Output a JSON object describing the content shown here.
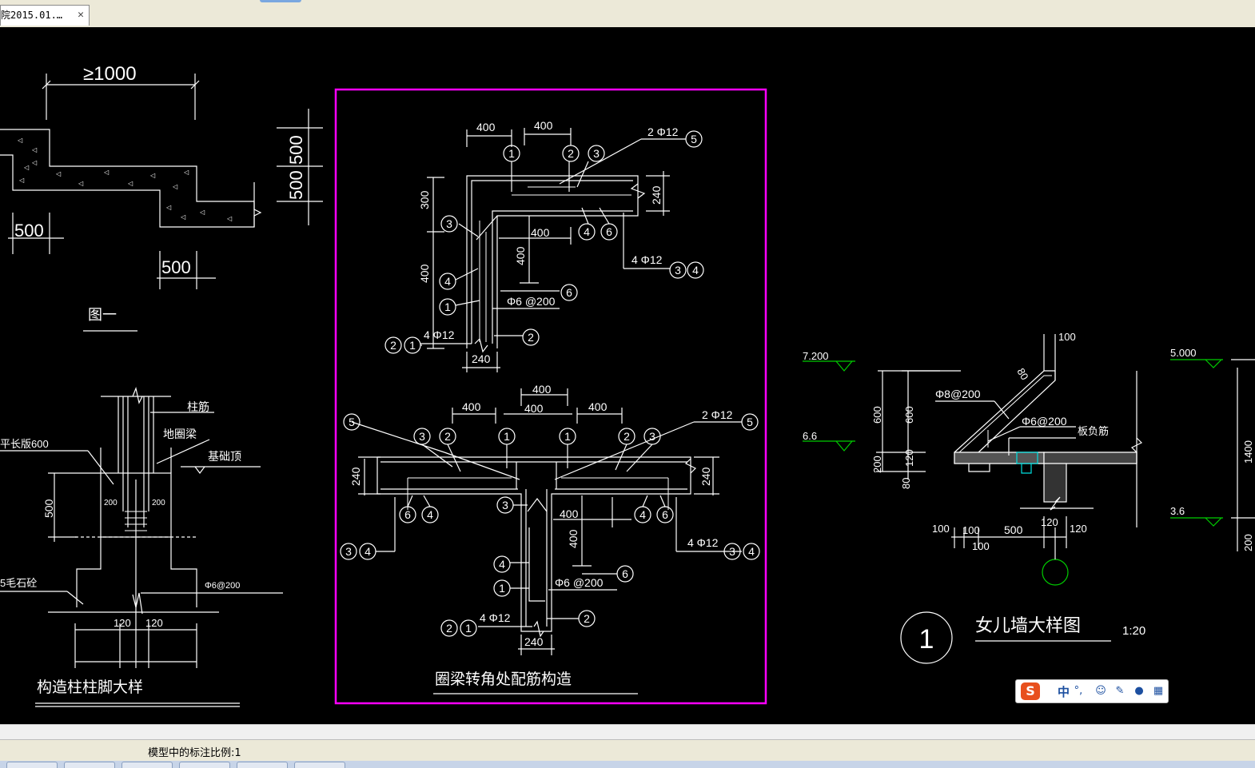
{
  "tab": {
    "title": "院2015.01.…",
    "close": "✕"
  },
  "status_bar": {
    "text": "模型中的标注比例:1"
  },
  "ime": {
    "logo": "S",
    "mode": "中",
    "punct": "°,",
    "icons": [
      "smiley-icon",
      "pen-icon",
      "microphone-icon",
      "grid-icon"
    ]
  },
  "colors": {
    "cad_background": "#000000",
    "line": "#ffffff",
    "frame": "#ff00ff",
    "level_marker": "#00cc00",
    "tab_bar": "#ece9d8"
  },
  "drawing": {
    "fig1": {
      "dim_top": "≥1000",
      "dim_left": "500",
      "dim_bottom": "500",
      "dim_right_top": "500",
      "dim_right_bottom": "500",
      "caption": "图一"
    },
    "column_foot": {
      "label_column_bar": "柱筋",
      "label_ground_beam": "地圈梁",
      "label_foundation_top": "基础顶",
      "label_bar_length": "平长版600",
      "label_rubble": "5毛石砼",
      "dim_height": "500",
      "dim_left_200": "200",
      "dim_right_200": "200",
      "dim_stirrup": "Φ6@200",
      "dim_left_120": "120",
      "dim_right_120": "120",
      "title": "构造柱柱脚大样"
    },
    "beam_corner": {
      "title": "圈梁转角处配筋构造",
      "l_dim_400_a": "400",
      "l_dim_400_b": "400",
      "l_rebar_2phi12": "2 Φ12",
      "l_dim_300": "300",
      "l_dim_240_right": "240",
      "l_dim_400_mid": "400",
      "l_dim_400_vert": "400",
      "l_dim_400_left": "400",
      "l_rebar_4phi12_right": "4 Φ12",
      "l_stirrup": "Φ6 @200",
      "l_rebar_4phi12_bottom": "4 Φ12",
      "l_dim_240_bottom": "240",
      "t_dim_400_top": "400",
      "t_dim_400_a": "400",
      "t_dim_400_b": "400",
      "t_dim_400_c": "400",
      "t_rebar_2phi12": "2 Φ12",
      "t_dim_240_left": "240",
      "t_dim_240_right": "240",
      "t_dim_400_mid": "400",
      "t_dim_400_vert": "400",
      "t_rebar_4phi12_right": "4 Φ12",
      "t_stirrup": "Φ6 @200",
      "t_rebar_4phi12_bottom": "4 Φ12",
      "t_dim_240_bottom": "240",
      "circles": [
        "1",
        "2",
        "3",
        "4",
        "5",
        "6"
      ]
    },
    "parapet": {
      "level_7200": "7.200",
      "level_66": "6.6",
      "level_5000": "5.000",
      "level_36": "3.6",
      "dim_100_top": "100",
      "dim_80_slope": "80",
      "rebar_phi8": "Φ8@200",
      "rebar_phi6": "Φ6@200",
      "label_slab_bar": "板负筋",
      "dim_600_a": "600",
      "dim_600_b": "600",
      "dim_200": "200",
      "dim_120": "120",
      "dim_80": "80",
      "dim_100_a": "100",
      "dim_100_b": "100",
      "dim_100_c": "100",
      "dim_500": "500",
      "dim_120_a": "120",
      "dim_120_b": "120",
      "dim_1400": "1400",
      "dim_200_right": "200",
      "detail_no": "1",
      "title": "女儿墙大样图",
      "scale": "1:20"
    }
  }
}
